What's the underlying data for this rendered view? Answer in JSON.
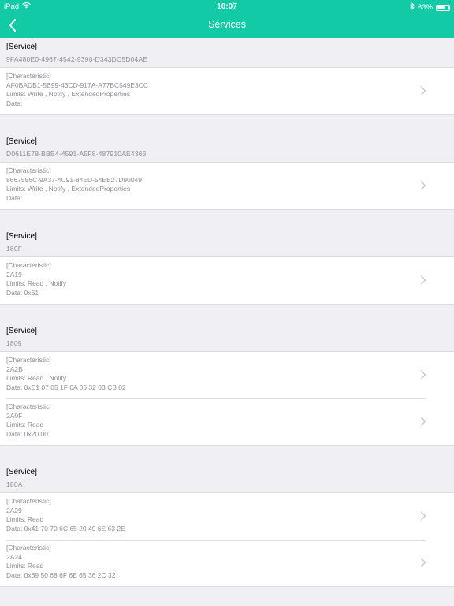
{
  "status_bar": {
    "device": "iPad",
    "time": "10:07",
    "battery": "63%",
    "battery_level": 0.63
  },
  "nav": {
    "title": "Services"
  },
  "labels": {
    "service": "[Service]",
    "characteristic": "[Characteristic]"
  },
  "services": [
    {
      "uuid": "9FA480E0-4967-4542-9390-D343DC5D04AE",
      "characteristics": [
        {
          "uuid": "AF0BADB1-5B99-43CD-917A-A77BC549E3CC",
          "limits": "Limits: Write , Notify , ExtendedProperties",
          "data": "Data:"
        }
      ]
    },
    {
      "uuid": "D0611E78-BBB4-4591-A5F8-487910AE4366",
      "characteristics": [
        {
          "uuid": "8667556C-9A37-4C91-84ED-54EE27D90049",
          "limits": "Limits: Write , Notify , ExtendedProperties",
          "data": "Data:"
        }
      ]
    },
    {
      "uuid": "180F",
      "characteristics": [
        {
          "uuid": "2A19",
          "limits": "Limits: Read , Notify",
          "data": "Data: 0x61"
        }
      ]
    },
    {
      "uuid": "1805",
      "characteristics": [
        {
          "uuid": "2A2B",
          "limits": "Limits: Read , Notify",
          "data": "Data: 0xE1 07 05 1F 0A 06 32 03 CB 02"
        },
        {
          "uuid": "2A0F",
          "limits": "Limits: Read",
          "data": "Data: 0x20 00"
        }
      ]
    },
    {
      "uuid": "180A",
      "characteristics": [
        {
          "uuid": "2A29",
          "limits": "Limits: Read",
          "data": "Data: 0x41 70 70 6C 65 20 49 6E 63 2E"
        },
        {
          "uuid": "2A24",
          "limits": "Limits: Read",
          "data": "Data: 0x69 50 68 6F 6E 65 36 2C 32"
        }
      ]
    }
  ],
  "colors": {
    "accent": "#12cba6",
    "background": "#efeff4",
    "secondary_text": "#8e8e93",
    "chevron": "#c7c7cc"
  },
  "icons": {
    "wifi": "wifi-icon",
    "bluetooth": "bluetooth-icon",
    "battery": "battery-icon",
    "back": "chevron-left-icon",
    "disclosure": "chevron-right-icon"
  }
}
